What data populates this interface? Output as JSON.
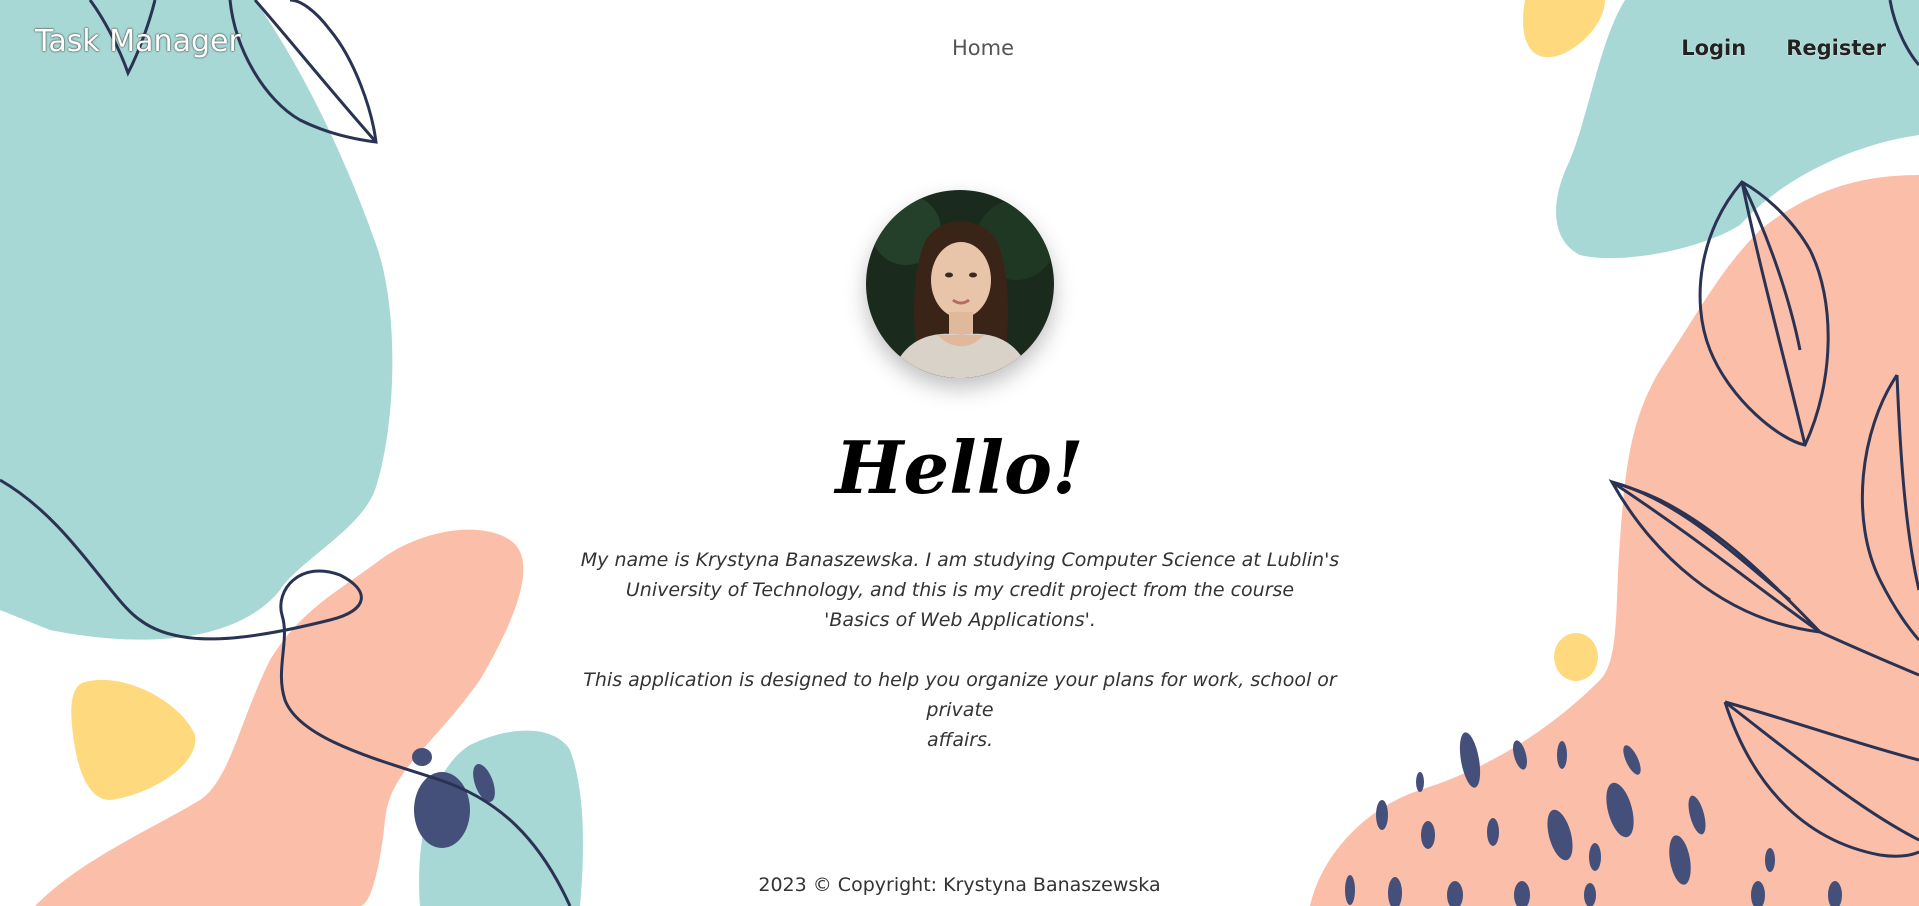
{
  "nav": {
    "brand": "Task Manager",
    "home": "Home",
    "login": "Login",
    "register": "Register"
  },
  "hero": {
    "heading": "Hello!",
    "paragraph1_line1": "My name is Krystyna Banaszewska. I am studying Computer Science at Lublin's",
    "paragraph1_line2": "University of Technology, and this is my credit project from the course",
    "paragraph1_line3": "'Basics of Web Applications'.",
    "paragraph2_line1": "This application is designed to help you organize your plans for work, school or private",
    "paragraph2_line2": "affairs."
  },
  "footer": {
    "copyright": "2023 © Copyright: Krystyna Banaszewska"
  },
  "colors": {
    "teal": "#a8d8d5",
    "peach": "#fbbfa9",
    "yellow": "#fed97e",
    "navy": "#2b3354",
    "dot_navy": "#44507a"
  }
}
